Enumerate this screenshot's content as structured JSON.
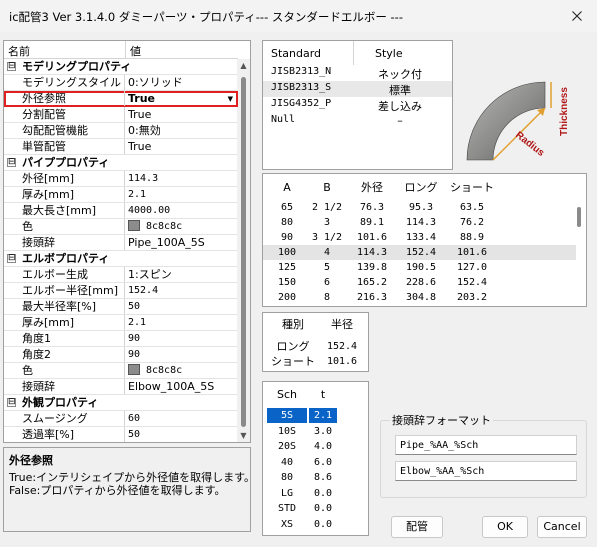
{
  "window": {
    "title": "ic配管3 Ver 3.1.4.0 ダミーパーツ・プロパティ--- スタンダードエルボー ---",
    "close_icon": "close-icon"
  },
  "propgrid": {
    "col_name": "名前",
    "col_value": "値",
    "toggle": "⊟",
    "dropdown_icon": "▼",
    "scroll_up": "▲",
    "scroll_down": "▼",
    "rows": [
      {
        "type": "cat",
        "key": "モデリングプロパティ"
      },
      {
        "key": "モデリングスタイル",
        "val": "0:ソリッド",
        "jp": true
      },
      {
        "key": "外径参照",
        "val": "True",
        "selected": true
      },
      {
        "key": "分割配管",
        "val": "True",
        "jp": true
      },
      {
        "key": "勾配配管機能",
        "val": "0:無効",
        "jp": true
      },
      {
        "key": "単管配管",
        "val": "True",
        "jp": true
      },
      {
        "type": "cat",
        "key": "パイププロパティ"
      },
      {
        "key": "外径[mm]",
        "val": "114.3"
      },
      {
        "key": "厚み[mm]",
        "val": "2.1"
      },
      {
        "key": "最大長さ[mm]",
        "val": "4000.00"
      },
      {
        "key": "色",
        "val": "8c8c8c",
        "swatch": true
      },
      {
        "key": "接頭辞",
        "val": "Pipe_100A_5S",
        "jp": true
      },
      {
        "type": "cat",
        "key": "エルボプロパティ"
      },
      {
        "key": "エルボー生成",
        "val": "1:スピン",
        "jp": true
      },
      {
        "key": "エルボー半径[mm]",
        "val": "152.4"
      },
      {
        "key": "最大半径率[%]",
        "val": "50"
      },
      {
        "key": "厚み[mm]",
        "val": "2.1"
      },
      {
        "key": "角度1",
        "val": "90"
      },
      {
        "key": "角度2",
        "val": "90"
      },
      {
        "key": "色",
        "val": "8c8c8c",
        "swatch": true
      },
      {
        "key": "接頭辞",
        "val": "Elbow_100A_5S",
        "jp": true
      },
      {
        "type": "cat",
        "key": "外観プロパティ"
      },
      {
        "key": "スムージング",
        "val": "60"
      },
      {
        "key": "透過率[%]",
        "val": "50"
      }
    ]
  },
  "description": {
    "title": "外径参照",
    "lines": [
      "True:インテリシェイプから外径値を取得します。",
      "False:プロパティから外径値を取得します。"
    ]
  },
  "standards": {
    "col1": "Standard",
    "col2": "Style",
    "rows": [
      {
        "std": "JISB2313_N",
        "style": "ネック付"
      },
      {
        "std": "JISB2313_S",
        "style": "標準",
        "selected": true
      },
      {
        "std": "JISG4352_P",
        "style": "差し込み"
      },
      {
        "std": "Null",
        "style": "–"
      }
    ]
  },
  "diagram": {
    "thickness_label": "Thickness",
    "radius_label": "Radius",
    "body_color": "#8a8a88",
    "accent_color": "#e0a030",
    "label_color": "#b01818"
  },
  "sizes": {
    "headers": [
      "A",
      "B",
      "外径",
      "ロング",
      "ショート"
    ],
    "rows": [
      [
        "65",
        "2 1/2",
        "76.3",
        "95.3",
        "63.5"
      ],
      [
        "80",
        "3",
        "89.1",
        "114.3",
        "76.2"
      ],
      [
        "90",
        "3 1/2",
        "101.6",
        "133.4",
        "88.9"
      ],
      [
        "100",
        "4",
        "114.3",
        "152.4",
        "101.6"
      ],
      [
        "125",
        "5",
        "139.8",
        "190.5",
        "127.0"
      ],
      [
        "150",
        "6",
        "165.2",
        "228.6",
        "152.4"
      ],
      [
        "200",
        "8",
        "216.3",
        "304.8",
        "203.2"
      ]
    ],
    "selected_index": 3
  },
  "radius_table": {
    "headers": [
      "種別",
      "半径"
    ],
    "rows": [
      [
        "ロング",
        "152.4"
      ],
      [
        "ショート",
        "101.6"
      ]
    ]
  },
  "sch": {
    "headers": [
      "Sch",
      "t"
    ],
    "rows": [
      [
        "5S",
        "2.1"
      ],
      [
        "10S",
        "3.0"
      ],
      [
        "20S",
        "4.0"
      ],
      [
        "40",
        "6.0"
      ],
      [
        "80",
        "8.6"
      ],
      [
        "LG",
        "0.0"
      ],
      [
        "STD",
        "0.0"
      ],
      [
        "XS",
        "0.0"
      ]
    ],
    "selected_index": 0
  },
  "prefix_format": {
    "label": "接頭辞フォーマット",
    "pipe": "Pipe_%AA_%Sch",
    "elbow": "Elbow_%AA_%Sch"
  },
  "buttons": {
    "pipe": "配管",
    "ok": "OK",
    "cancel": "Cancel"
  }
}
